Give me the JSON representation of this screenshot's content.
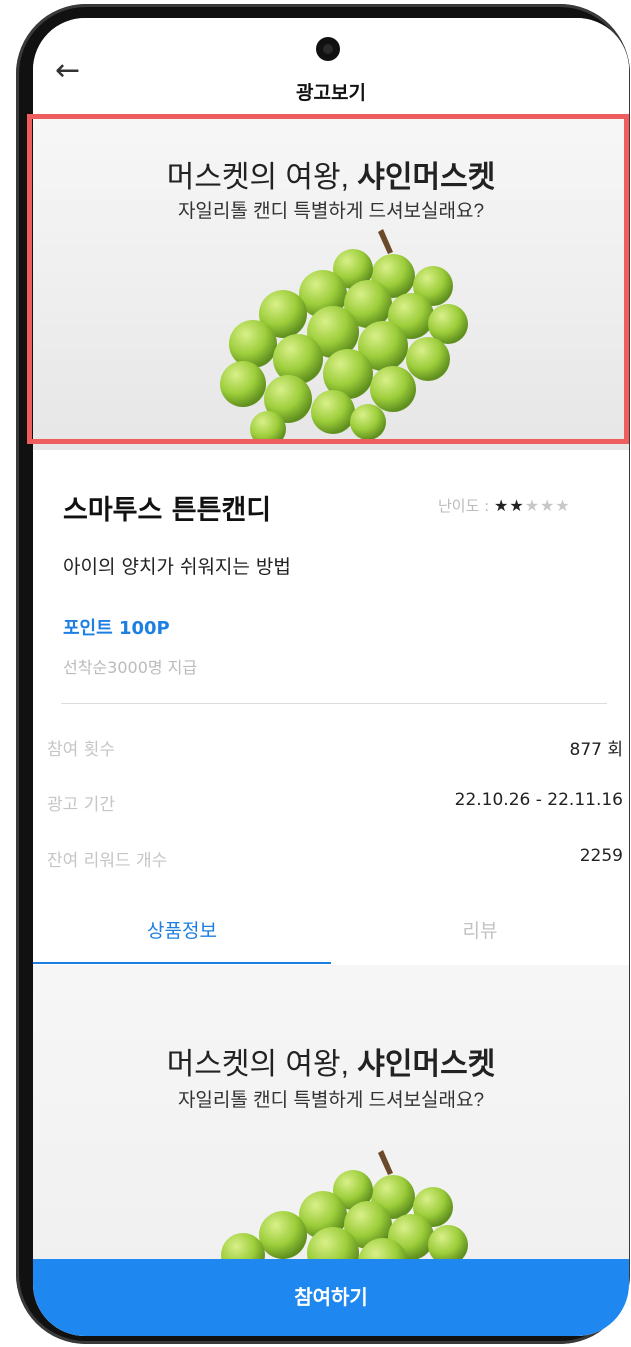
{
  "header": {
    "title": "광고보기",
    "back_icon": "arrow-left-icon"
  },
  "banner": {
    "headline_plain": "머스켓의 여왕, ",
    "headline_bold": "샤인머스켓",
    "subline": "자일리톨 캔디 특별하게 드셔보실래요?"
  },
  "product": {
    "name": "스마투스 튼튼캔디",
    "difficulty_label": "난이도 :",
    "difficulty_rating": 2,
    "difficulty_max": 5,
    "description": "아이의 양치가 쉬워지는 방법",
    "points": "포인트 100P",
    "points_note": "선착순3000명 지급"
  },
  "stats": [
    {
      "label": "참여 횟수",
      "value": "877 회"
    },
    {
      "label": "광고 기간",
      "value": "22.10.26 - 22.11.16"
    },
    {
      "label": "잔여 리워드 개수",
      "value": "2259"
    }
  ],
  "tabs": [
    {
      "label": "상품정보",
      "active": true
    },
    {
      "label": "리뷰",
      "active": false
    }
  ],
  "content_banner": {
    "headline_plain": "머스켓의 여왕, ",
    "headline_bold": "샤인머스켓",
    "subline": "자일리톨 캔디 특별하게 드셔보실래요?"
  },
  "cta": {
    "label": "참여하기"
  },
  "colors": {
    "accent": "#1e88f0",
    "highlight": "#ee5e5e",
    "star_filled": "#222222",
    "star_empty": "#c8c8c8"
  }
}
